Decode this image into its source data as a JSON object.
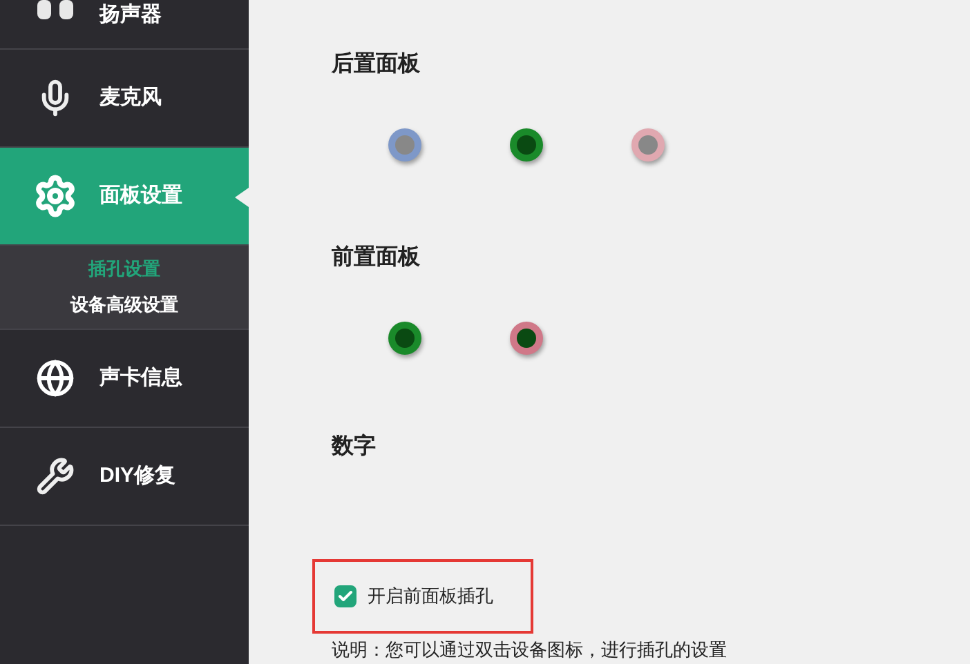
{
  "sidebar": {
    "items": [
      {
        "label": "扬声器",
        "selected": false
      },
      {
        "label": "麦克风",
        "selected": false
      },
      {
        "label": "面板设置",
        "selected": true,
        "children": [
          {
            "label": "插孔设置",
            "selected": true
          },
          {
            "label": "设备高级设置",
            "selected": false
          }
        ]
      },
      {
        "label": "声卡信息",
        "selected": false
      },
      {
        "label": "DIY修复",
        "selected": false
      }
    ]
  },
  "sections": [
    {
      "title": "后置面板",
      "jacks": [
        {
          "color": "#7e98c8",
          "plugged": false
        },
        {
          "color": "#1a8a2a",
          "plugged": true
        },
        {
          "color": "#e0a8b0",
          "plugged": false
        }
      ]
    },
    {
      "title": "前置面板",
      "jacks": [
        {
          "color": "#1a8a2a",
          "plugged": true
        },
        {
          "color": "#d07888",
          "plugged": true
        }
      ]
    },
    {
      "title": "数字"
    }
  ],
  "option": {
    "label": "开启前面板插孔",
    "checked": true,
    "highlighted": true
  },
  "note": "说明：您可以通过双击设备图标，进行插孔的设置"
}
